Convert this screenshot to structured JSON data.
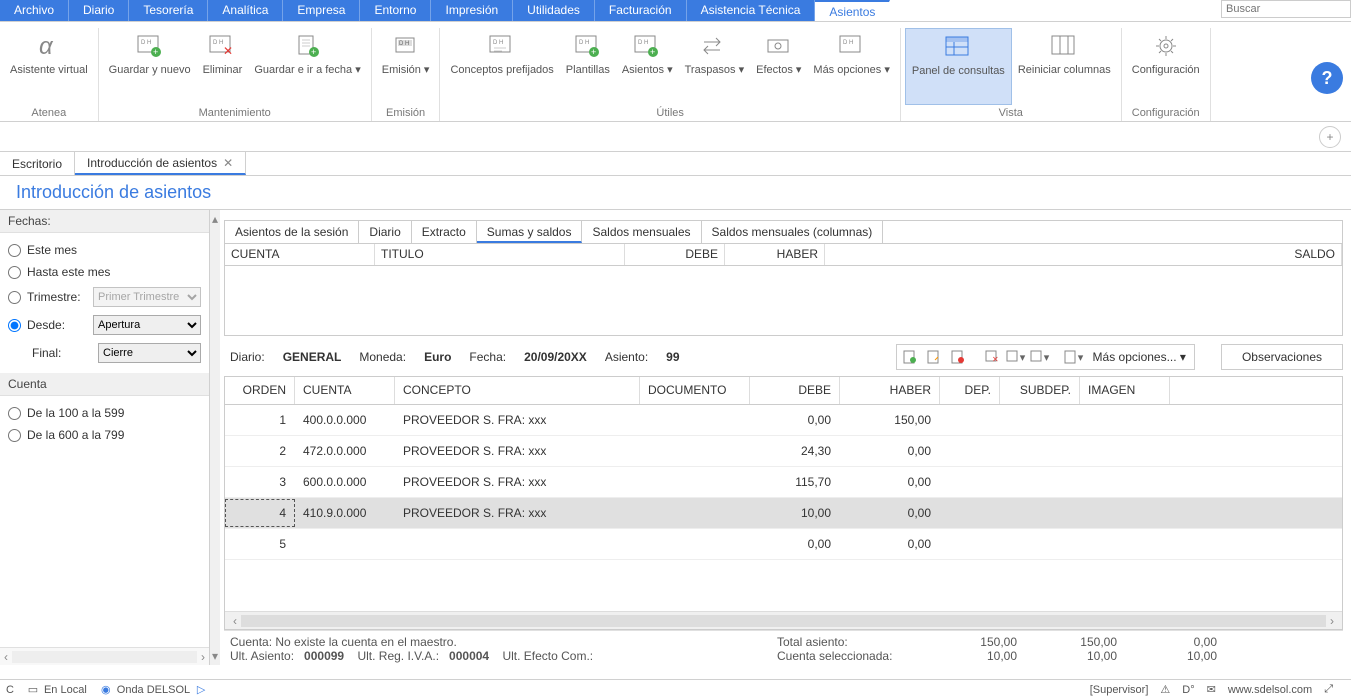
{
  "menubar": {
    "items": [
      "Archivo",
      "Diario",
      "Tesorería",
      "Analítica",
      "Empresa",
      "Entorno",
      "Impresión",
      "Utilidades",
      "Facturación",
      "Asistencia Técnica",
      "Asientos"
    ],
    "active_index": 10,
    "search_placeholder": "Buscar"
  },
  "ribbon": {
    "groups": [
      {
        "title": "Atenea",
        "buttons": [
          {
            "label": "Asistente virtual",
            "icon": "alpha-icon"
          }
        ]
      },
      {
        "title": "Mantenimiento",
        "buttons": [
          {
            "label": "Guardar y nuevo",
            "icon": "save-new-icon"
          },
          {
            "label": "Eliminar",
            "icon": "delete-icon"
          },
          {
            "label": "Guardar e ir a fecha ▾",
            "icon": "save-goto-icon"
          }
        ]
      },
      {
        "title": "Emisión",
        "buttons": [
          {
            "label": "Emisión ▾",
            "icon": "emit-icon"
          }
        ]
      },
      {
        "title": "Útiles",
        "buttons": [
          {
            "label": "Conceptos prefijados",
            "icon": "concepts-icon"
          },
          {
            "label": "Plantillas",
            "icon": "templates-icon"
          },
          {
            "label": "Asientos ▾",
            "icon": "entries-icon"
          },
          {
            "label": "Traspasos ▾",
            "icon": "transfers-icon"
          },
          {
            "label": "Efectos ▾",
            "icon": "effects-icon"
          },
          {
            "label": "Más opciones ▾",
            "icon": "more-icon"
          }
        ]
      },
      {
        "title": "Vista",
        "buttons": [
          {
            "label": "Panel de consultas",
            "icon": "panel-icon",
            "active": true
          },
          {
            "label": "Reiniciar columnas",
            "icon": "reset-cols-icon"
          }
        ]
      },
      {
        "title": "Configuración",
        "buttons": [
          {
            "label": "Configuración",
            "icon": "gear-icon"
          }
        ]
      }
    ]
  },
  "doc_tabs": [
    {
      "label": "Escritorio",
      "active": false,
      "closable": false
    },
    {
      "label": "Introducción de asientos",
      "active": true,
      "closable": true
    }
  ],
  "page": {
    "title": "Introducción de asientos"
  },
  "filters": {
    "header_fechas": "Fechas:",
    "header_cuenta": "Cuenta",
    "radio_este_mes": "Este mes",
    "radio_hasta_mes": "Hasta este mes",
    "radio_trimestre": "Trimestre:",
    "trimestre_value": "Primer Trimestre",
    "radio_desde": "Desde:",
    "desde_value": "Apertura",
    "final_label": "Final:",
    "final_value": "Cierre",
    "radio_cuenta_100": "De la 100 a la 599",
    "radio_cuenta_600": "De la 600 a la 799"
  },
  "query_tabs": [
    "Asientos de la sesión",
    "Diario",
    "Extracto",
    "Sumas y saldos",
    "Saldos mensuales",
    "Saldos mensuales (columnas)"
  ],
  "query_tabs_active": 3,
  "query_headers": {
    "cuenta": "CUENTA",
    "titulo": "TITULO",
    "debe": "DEBE",
    "haber": "HABER",
    "saldo": "SALDO"
  },
  "entry_info": {
    "diario_label": "Diario:",
    "diario_value": "GENERAL",
    "moneda_label": "Moneda:",
    "moneda_value": "Euro",
    "fecha_label": "Fecha:",
    "fecha_value": "20/09/20XX",
    "asiento_label": "Asiento:",
    "asiento_value": "99",
    "more_options": "Más opciones...",
    "observaciones": "Observaciones"
  },
  "grid": {
    "headers": {
      "orden": "ORDEN",
      "cuenta": "CUENTA",
      "concepto": "CONCEPTO",
      "documento": "DOCUMENTO",
      "debe": "DEBE",
      "haber": "HABER",
      "dep": "DEP.",
      "subdep": "SUBDEP.",
      "imagen": "IMAGEN"
    },
    "rows": [
      {
        "orden": "1",
        "cuenta": "400.0.0.000",
        "concepto": "PROVEEDOR S. FRA:  xxx",
        "documento": "",
        "debe": "0,00",
        "haber": "150,00",
        "dep": "",
        "subdep": "",
        "imagen": ""
      },
      {
        "orden": "2",
        "cuenta": "472.0.0.000",
        "concepto": "PROVEEDOR S. FRA:  xxx",
        "documento": "",
        "debe": "24,30",
        "haber": "0,00",
        "dep": "",
        "subdep": "",
        "imagen": ""
      },
      {
        "orden": "3",
        "cuenta": "600.0.0.000",
        "concepto": "PROVEEDOR S. FRA:  xxx",
        "documento": "",
        "debe": "115,70",
        "haber": "0,00",
        "dep": "",
        "subdep": "",
        "imagen": ""
      },
      {
        "orden": "4",
        "cuenta": "410.9.0.000",
        "concepto": "PROVEEDOR S. FRA:  xxx",
        "documento": "",
        "debe": "10,00",
        "haber": "0,00",
        "dep": "",
        "subdep": "",
        "imagen": "",
        "selected": true
      },
      {
        "orden": "5",
        "cuenta": "",
        "concepto": "",
        "documento": "",
        "debe": "0,00",
        "haber": "0,00",
        "dep": "",
        "subdep": "",
        "imagen": ""
      }
    ]
  },
  "footer": {
    "cuenta_msg": "Cuenta: No existe la cuenta en el maestro.",
    "ult_asiento_label": "Ult. Asiento:",
    "ult_asiento_value": "000099",
    "ult_reg_iva_label": "Ult. Reg. I.V.A.:",
    "ult_reg_iva_value": "000004",
    "ult_efecto_label": "Ult. Efecto Com.:",
    "total_asiento_label": "Total asiento:",
    "cuenta_sel_label": "Cuenta seleccionada:",
    "totals": {
      "debe": "150,00",
      "haber": "150,00",
      "saldo": "0,00",
      "sel_debe": "10,00",
      "sel_haber": "10,00",
      "sel_saldo": "10,00"
    }
  },
  "status": {
    "en_local": "En Local",
    "onda": "Onda DELSOL",
    "supervisor": "[Supervisor]",
    "url": "www.sdelsol.com"
  }
}
